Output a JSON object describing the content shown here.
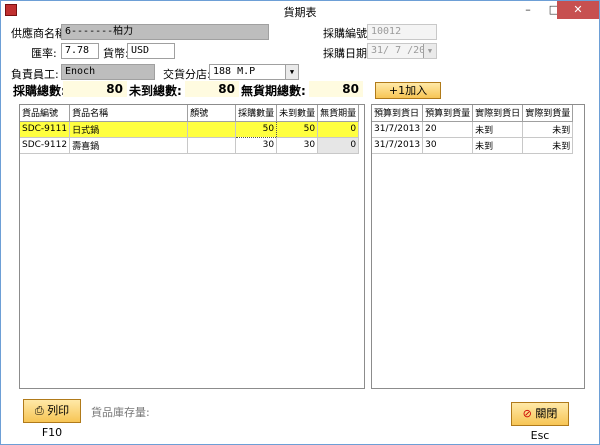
{
  "window": {
    "title": "貨期表"
  },
  "header": {
    "supplier_label": "供應商名稱:",
    "supplier_value": "6-------柏力",
    "rate_label": "匯率:",
    "rate_value": "7.78",
    "currency_label": "貨幣:",
    "currency_value": "USD",
    "staff_label": "負責員工:",
    "staff_value": "Enoch",
    "branch_label": "交貨分店:",
    "branch_value": "188 M.P",
    "po_no_label": "採購編號:",
    "po_no_value": "10012",
    "po_date_label": "採購日期:",
    "po_date_value": "31/ 7 /2013"
  },
  "totals": {
    "purchase_label": "採購總數:",
    "purchase_value": "80",
    "undelivered_label": "未到總數:",
    "undelivered_value": "80",
    "no_date_label": "無貨期總數:",
    "no_date_value": "80"
  },
  "add_button": "+1加入",
  "items_table": {
    "headers": [
      "貨品編號",
      "貨品名稱",
      "顏號",
      "採購數量",
      "未到數量",
      "無貨期量"
    ],
    "rows": [
      [
        "SDC-9111",
        "日式鍋",
        "",
        "50",
        "50",
        "0"
      ],
      [
        "SDC-9112",
        "壽喜鍋",
        "",
        "30",
        "30",
        "0"
      ]
    ]
  },
  "schedule_table": {
    "headers": [
      "預算到貨日",
      "預算到貨量",
      "實際到貨日",
      "實際到貨量"
    ],
    "rows": [
      [
        "31/7/2013",
        "20",
        "未到",
        "未到"
      ],
      [
        "31/7/2013",
        "30",
        "未到",
        "未到"
      ]
    ]
  },
  "footer": {
    "print_button": "列印 F10",
    "stock_label": "貨品庫存量:",
    "close_button": "關閉 Esc"
  },
  "colors": {
    "selected_row": "#ffff40",
    "accent_button": "#f7c555"
  }
}
